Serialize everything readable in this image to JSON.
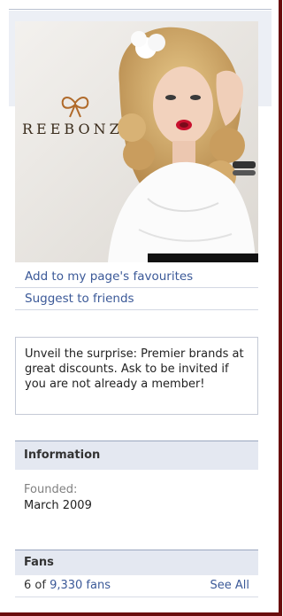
{
  "profile": {
    "brand_logo_text": "REEBONZ",
    "photo_subject": "woman-portrait"
  },
  "links": {
    "add_favourites": "Add to my page's favourites",
    "suggest_friends": "Suggest to friends"
  },
  "about": {
    "text": "Unveil the surprise: Premier brands at great discounts. Ask to be invited if you are not already a member!"
  },
  "information": {
    "header": "Information",
    "founded_label": "Founded:",
    "founded_value": "March 2009"
  },
  "fans": {
    "header": "Fans",
    "count_prefix": "6 of ",
    "count_link": "9,330 fans",
    "see_all": "See All"
  },
  "colors": {
    "link": "#3b5998",
    "frame": "#6a0d0d",
    "section_bg": "#e4e8f1"
  }
}
